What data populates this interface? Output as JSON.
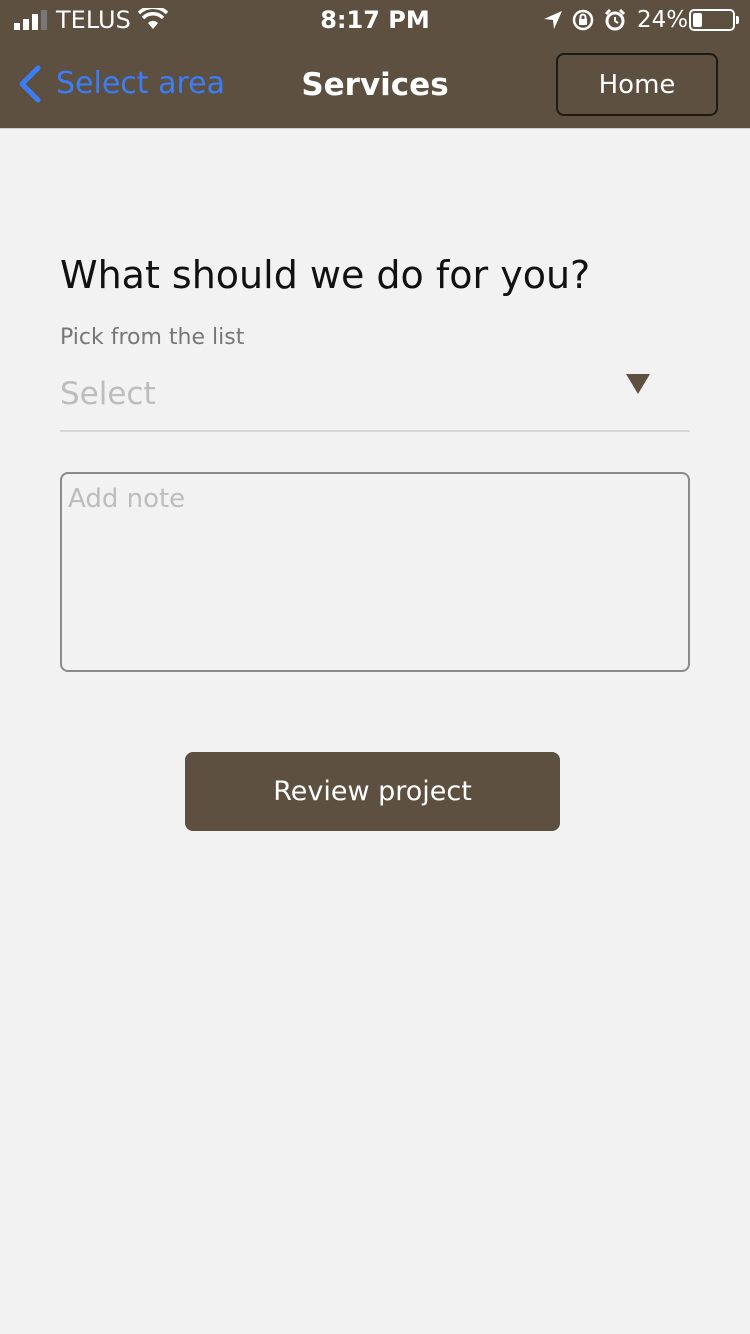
{
  "status_bar": {
    "carrier": "TELUS",
    "time": "8:17 PM",
    "battery_percent": "24%",
    "battery_level": 0.24,
    "icons": [
      "signal-icon",
      "wifi-icon",
      "location-arrow-icon",
      "orientation-lock-icon",
      "alarm-icon",
      "battery-icon"
    ]
  },
  "nav": {
    "back_label": "Select area",
    "title": "Services",
    "home_label": "Home"
  },
  "form": {
    "heading": "What should we do for you?",
    "select_label": "Pick from the list",
    "select_value": "Select",
    "note_placeholder": "Add note",
    "submit_label": "Review project"
  },
  "colors": {
    "header": "#5e5040",
    "back_link": "#3a7df5",
    "background": "#f2f2f2",
    "primary_button": "#5e5040"
  }
}
